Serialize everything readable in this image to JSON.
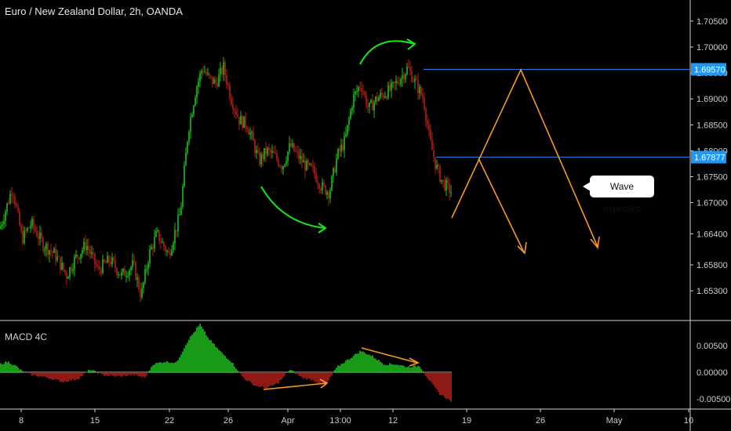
{
  "title": "Euro / New Zealand Dollar, 2h, OANDA",
  "macd_title": "MACD 4C",
  "note": "Wave expected",
  "colors": {
    "bull": "#1fbf1f",
    "bear": "#b0201a",
    "hline": "#2a7fd4",
    "badge": "#2196f3",
    "arrow_green": "#19e619",
    "arrow_orange": "#f59a23",
    "grid_text": "#cccccc"
  },
  "chart_data": {
    "type": "candlestick",
    "price_axis": {
      "ticks": [
        "1.70500",
        "1.70000",
        "1.69500",
        "1.69000",
        "1.68500",
        "1.68000",
        "1.67500",
        "1.67000",
        "1.66400",
        "1.65800",
        "1.65300"
      ]
    },
    "x_axis": {
      "ticks": [
        "8",
        "15",
        "22",
        "26",
        "Apr",
        "13:00",
        "12",
        "19",
        "26",
        "May",
        "10"
      ]
    },
    "levels": [
      {
        "label": "1.69570",
        "value": 1.6957
      },
      {
        "label": "1.67877",
        "value": 1.67877
      }
    ],
    "macd_axis": {
      "ticks": [
        "0.00500",
        "0.00000",
        "-0.00500"
      ]
    },
    "price_path": [
      [
        0,
        1.665
      ],
      [
        16,
        1.673
      ],
      [
        28,
        1.663
      ],
      [
        40,
        1.666
      ],
      [
        55,
        1.662
      ],
      [
        70,
        1.66
      ],
      [
        85,
        1.656
      ],
      [
        95,
        1.659
      ],
      [
        110,
        1.662
      ],
      [
        125,
        1.657
      ],
      [
        140,
        1.659
      ],
      [
        155,
        1.656
      ],
      [
        170,
        1.658
      ],
      [
        180,
        1.652
      ],
      [
        190,
        1.66
      ],
      [
        200,
        1.664
      ],
      [
        215,
        1.66
      ],
      [
        230,
        1.668
      ],
      [
        240,
        1.684
      ],
      [
        250,
        1.692
      ],
      [
        258,
        1.696
      ],
      [
        266,
        1.694
      ],
      [
        275,
        1.693
      ],
      [
        285,
        1.696
      ],
      [
        295,
        1.69
      ],
      [
        305,
        1.686
      ],
      [
        315,
        1.685
      ],
      [
        322,
        1.682
      ],
      [
        330,
        1.678
      ],
      [
        340,
        1.68
      ],
      [
        350,
        1.679
      ],
      [
        360,
        1.677
      ],
      [
        370,
        1.681
      ],
      [
        380,
        1.679
      ],
      [
        390,
        1.677
      ],
      [
        400,
        1.676
      ],
      [
        410,
        1.673
      ],
      [
        420,
        1.672
      ],
      [
        430,
        1.679
      ],
      [
        440,
        1.682
      ],
      [
        450,
        1.69
      ],
      [
        460,
        1.693
      ],
      [
        470,
        1.688
      ],
      [
        480,
        1.69
      ],
      [
        490,
        1.691
      ],
      [
        500,
        1.692
      ],
      [
        510,
        1.694
      ],
      [
        520,
        1.696
      ],
      [
        530,
        1.693
      ],
      [
        540,
        1.69
      ],
      [
        548,
        1.682
      ],
      [
        556,
        1.677
      ],
      [
        564,
        1.674
      ],
      [
        576,
        1.672
      ]
    ],
    "macd_hist": [
      [
        0,
        0.0015
      ],
      [
        10,
        0.002
      ],
      [
        20,
        0.0012
      ],
      [
        30,
        0.0
      ],
      [
        40,
        -0.0005
      ],
      [
        60,
        -0.001
      ],
      [
        80,
        -0.0018
      ],
      [
        100,
        -0.0012
      ],
      [
        115,
        0.0005
      ],
      [
        130,
        -0.0005
      ],
      [
        150,
        -0.0008
      ],
      [
        170,
        -0.0005
      ],
      [
        185,
        -0.001
      ],
      [
        195,
        0.0015
      ],
      [
        210,
        0.002
      ],
      [
        225,
        0.0018
      ],
      [
        240,
        0.006
      ],
      [
        255,
        0.009
      ],
      [
        265,
        0.0065
      ],
      [
        280,
        0.004
      ],
      [
        295,
        0.002
      ],
      [
        310,
        -0.001
      ],
      [
        325,
        -0.0025
      ],
      [
        340,
        -0.003
      ],
      [
        355,
        -0.002
      ],
      [
        370,
        0.0005
      ],
      [
        385,
        -0.001
      ],
      [
        400,
        -0.0015
      ],
      [
        415,
        -0.0025
      ],
      [
        430,
        0.001
      ],
      [
        445,
        0.0025
      ],
      [
        460,
        0.004
      ],
      [
        475,
        0.003
      ],
      [
        490,
        0.0015
      ],
      [
        505,
        0.0015
      ],
      [
        520,
        0.001
      ],
      [
        535,
        0.0012
      ],
      [
        545,
        -0.001
      ],
      [
        560,
        -0.004
      ],
      [
        576,
        -0.0055
      ]
    ]
  }
}
